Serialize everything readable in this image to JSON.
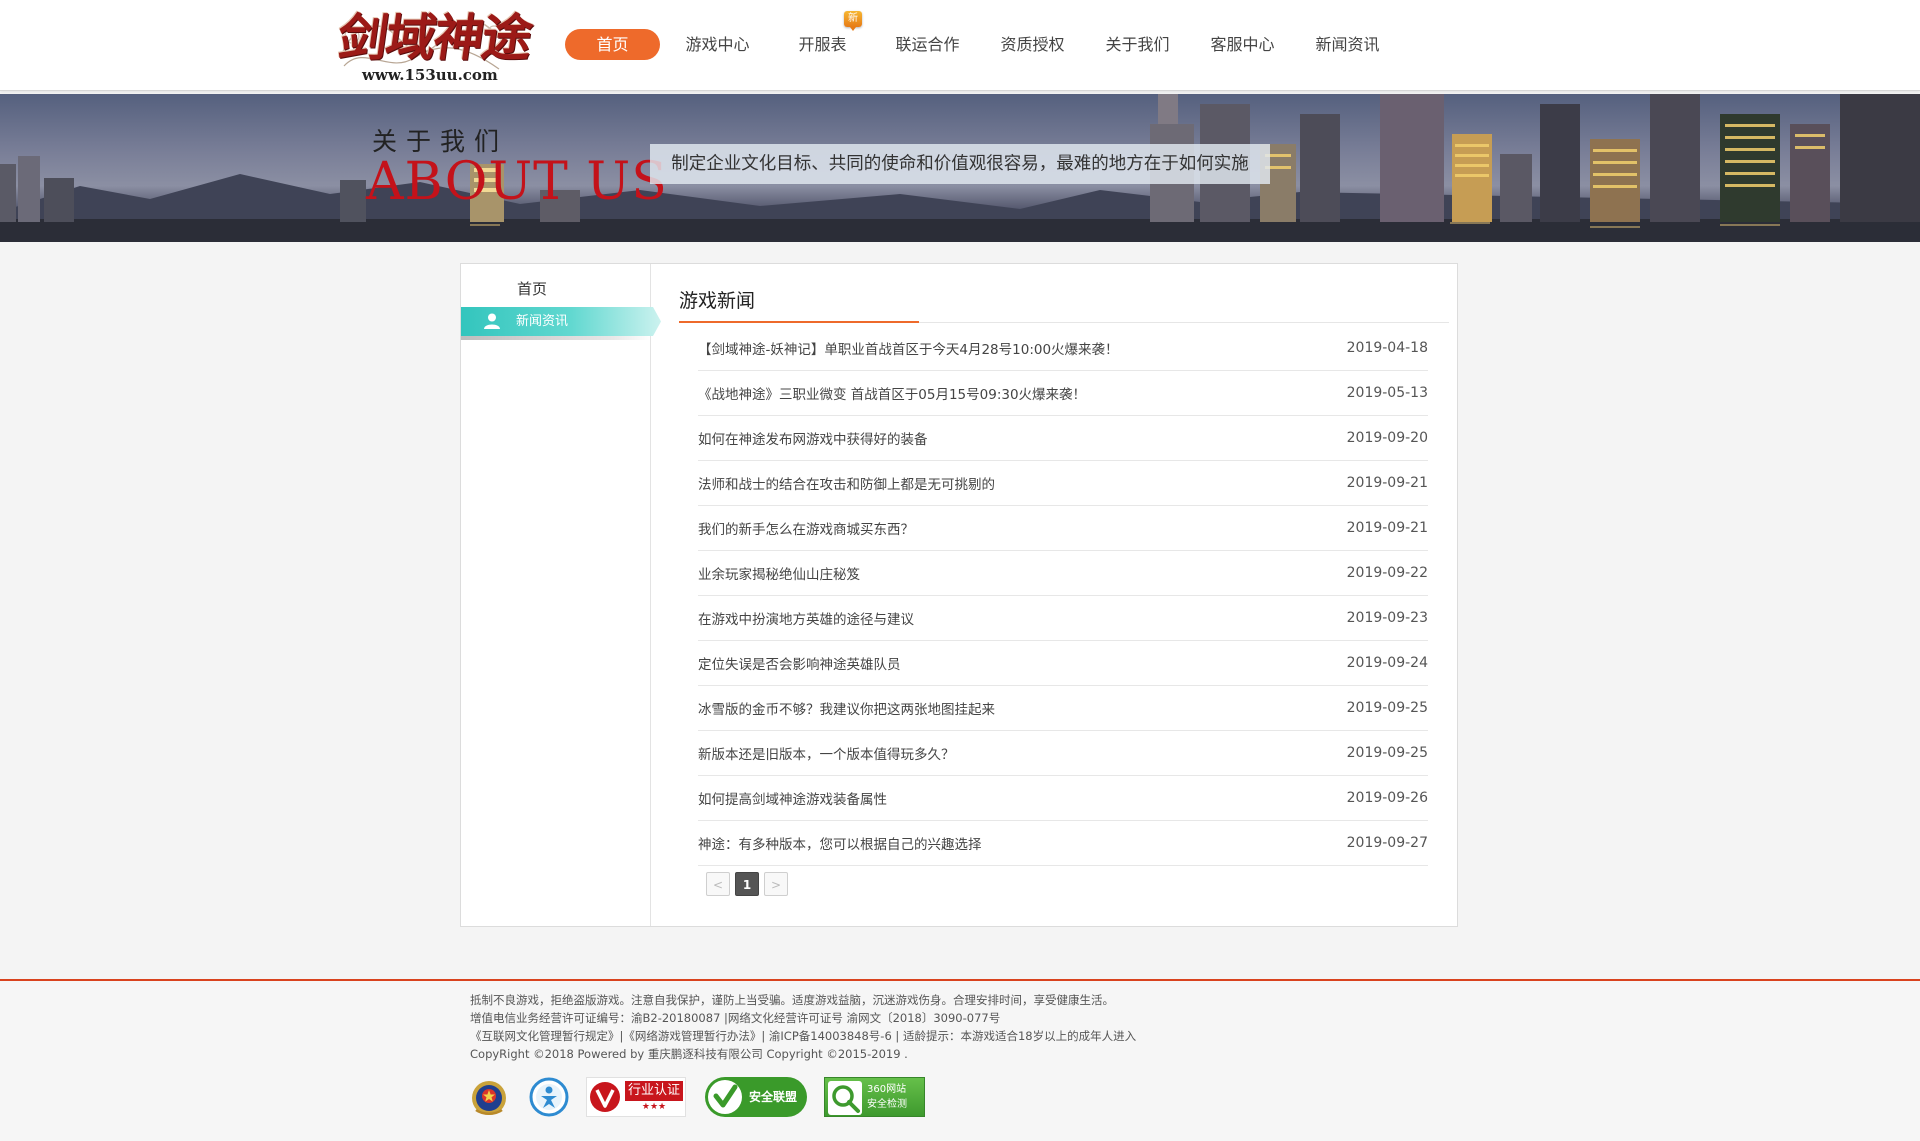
{
  "header": {
    "logo": {
      "title": "剑域神途",
      "url": "www.153uu.com"
    },
    "nav": [
      {
        "label": "首页",
        "active": true
      },
      {
        "label": "游戏中心"
      },
      {
        "label": "开服表",
        "badge": "新"
      },
      {
        "label": "联运合作"
      },
      {
        "label": "资质授权"
      },
      {
        "label": "关于我们"
      },
      {
        "label": "客服中心"
      },
      {
        "label": "新闻资讯"
      }
    ]
  },
  "banner": {
    "title_cn": "关于我们",
    "title_en": "ABOUT US",
    "slogan": "制定企业文化目标、共同的使命和价值观很容易，最难的地方在于如何实施"
  },
  "sidebar": {
    "title": "首页",
    "items": [
      {
        "label": "新闻资讯",
        "icon": "user-icon",
        "active": true
      }
    ]
  },
  "content": {
    "title": "游戏新闻",
    "news": [
      {
        "title": "【剑域神途-妖神记】单职业首战首区于今天4月28号10:00火爆来袭！",
        "date": "2019-04-18"
      },
      {
        "title": "《战地神途》三职业微变 首战首区于05月15号09:30火爆来袭！",
        "date": "2019-05-13"
      },
      {
        "title": "如何在神途发布网游戏中获得好的装备",
        "date": "2019-09-20"
      },
      {
        "title": "法师和战士的结合在攻击和防御上都是无可挑剔的",
        "date": "2019-09-21"
      },
      {
        "title": "我们的新手怎么在游戏商城买东西？",
        "date": "2019-09-21"
      },
      {
        "title": "业余玩家揭秘绝仙山庄秘笈",
        "date": "2019-09-22"
      },
      {
        "title": "在游戏中扮演地方英雄的途径与建议",
        "date": "2019-09-23"
      },
      {
        "title": "定位失误是否会影响神途英雄队员",
        "date": "2019-09-24"
      },
      {
        "title": "冰雪版的金币不够？我建议你把这两张地图挂起来",
        "date": "2019-09-25"
      },
      {
        "title": "新版本还是旧版本，一个版本值得玩多久？",
        "date": "2019-09-25"
      },
      {
        "title": "如何提高剑域神途游戏装备属性",
        "date": "2019-09-26"
      },
      {
        "title": "神途：有多种版本，您可以根据自己的兴趣选择",
        "date": "2019-09-27"
      }
    ],
    "pager": {
      "prev": "<",
      "current": "1",
      "next": ">"
    }
  },
  "footer": {
    "lines": [
      "抵制不良游戏，拒绝盗版游戏。注意自我保护，谨防上当受骗。适度游戏益脑，沉迷游戏伤身。合理安排时间，享受健康生活。",
      "增值电信业务经营许可证编号：渝B2-20180087 |网络文化经营许可证号 渝网文〔2018〕3090-077号",
      "《互联网文化管理暂行规定》|《网络游戏管理暂行办法》| 渝ICP备14003848号-6 | 适龄提示：本游戏适合18岁以上的成年人进入",
      "CopyRight ©2018 Powered by 重庆鹏逐科技有限公司 Copyright ©2015-2019 ."
    ],
    "badges": [
      {
        "icon": "police-emblem-icon"
      },
      {
        "icon": "service-man-icon"
      },
      {
        "icon": "industry-cert-icon",
        "text": "行业认证",
        "stars": "★★★"
      },
      {
        "icon": "security-alliance-icon",
        "text": "安全联盟"
      },
      {
        "icon": "360-security-icon",
        "text1": "360网站",
        "text2": "安全检测"
      }
    ]
  }
}
